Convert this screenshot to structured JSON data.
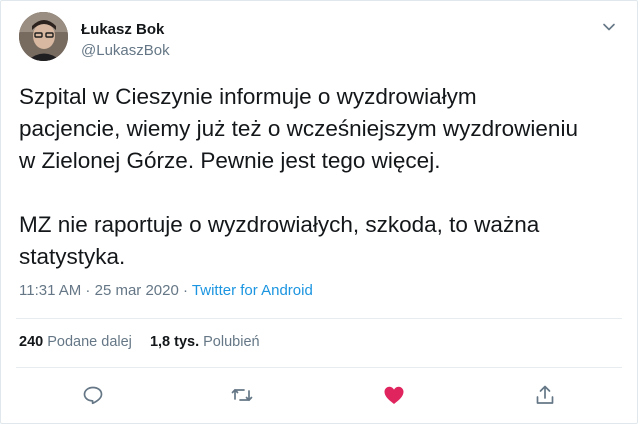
{
  "tweet": {
    "author_name": "Łukasz Bok",
    "author_handle": "@LukaszBok",
    "text": "Szpital w Cieszynie informuje o wyzdrowiałym\npacjencie, wiemy już też o wcześniejszym wyzdrowieniu\nw Zielonej Górze. Pewnie jest tego więcej.\n\nMZ nie raportuje o wyzdrowiałych, szkoda, to ważna\nstatystyka.",
    "time": "11:31 AM",
    "separator": " · ",
    "date": "25 mar 2020",
    "source": "Twitter for Android"
  },
  "stats": {
    "retweets_count": "240",
    "retweets_label": "Podane dalej",
    "likes_count": "1,8 tys.",
    "likes_label": "Polubień"
  },
  "icons": {
    "caret": "chevron-down-icon",
    "reply": "reply-icon",
    "retweet": "retweet-icon",
    "like": "heart-icon",
    "share": "share-icon"
  },
  "colors": {
    "link": "#1b95e0",
    "like": "#e0245e",
    "muted": "#657786",
    "text": "#14171a"
  }
}
